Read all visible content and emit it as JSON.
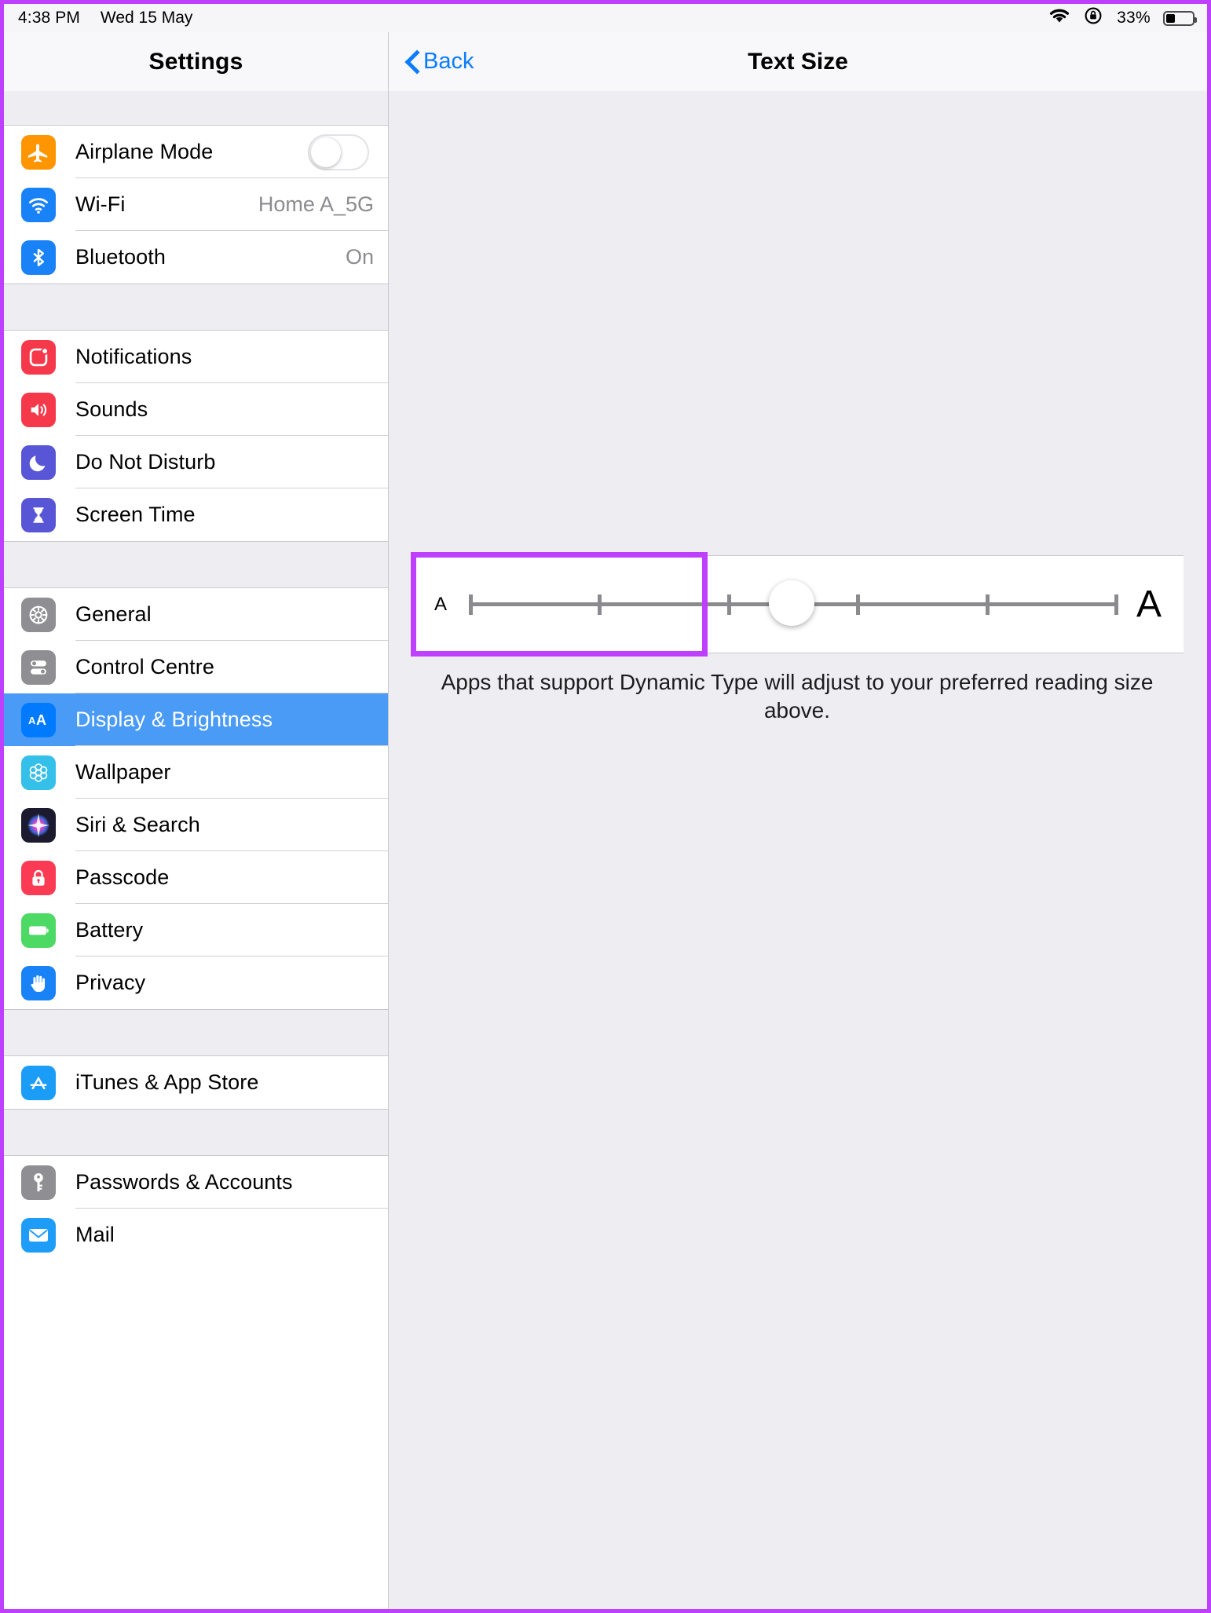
{
  "statusbar": {
    "time": "4:38 PM",
    "date": "Wed 15 May",
    "wifi_icon": "wifi-icon",
    "rotation_lock_icon": "rotation-lock-icon",
    "battery_percent": "33%",
    "battery_level": 33
  },
  "sidebar": {
    "title": "Settings",
    "groups": [
      {
        "items": [
          {
            "label": "Airplane Mode",
            "icon": "airplane-icon",
            "icon_class": "ic-airplane",
            "glyph": "✈",
            "control": "toggle",
            "toggle_on": false
          },
          {
            "label": "Wi-Fi",
            "icon": "wifi-icon",
            "icon_class": "ic-wifi",
            "glyph": "◴",
            "value": "Home A_5G"
          },
          {
            "label": "Bluetooth",
            "icon": "bluetooth-icon",
            "icon_class": "ic-bluetooth",
            "glyph": "ᛦ",
            "value": "On"
          }
        ]
      },
      {
        "items": [
          {
            "label": "Notifications",
            "icon": "notifications-icon",
            "icon_class": "ic-notifications",
            "glyph": "▢"
          },
          {
            "label": "Sounds",
            "icon": "sounds-icon",
            "icon_class": "ic-sounds",
            "glyph": "◂"
          },
          {
            "label": "Do Not Disturb",
            "icon": "moon-icon",
            "icon_class": "ic-dnd",
            "glyph": "☾"
          },
          {
            "label": "Screen Time",
            "icon": "hourglass-icon",
            "icon_class": "ic-screentime",
            "glyph": "⧖"
          }
        ]
      },
      {
        "items": [
          {
            "label": "General",
            "icon": "gear-icon",
            "icon_class": "ic-general",
            "glyph": "⚙"
          },
          {
            "label": "Control Centre",
            "icon": "sliders-icon",
            "icon_class": "ic-control",
            "glyph": "☲"
          },
          {
            "label": "Display & Brightness",
            "icon": "text-size-icon",
            "icon_class": "ic-display",
            "glyph": "AA",
            "selected": true
          },
          {
            "label": "Wallpaper",
            "icon": "flower-icon",
            "icon_class": "ic-wallpaper",
            "glyph": "✿"
          },
          {
            "label": "Siri & Search",
            "icon": "siri-icon",
            "icon_class": "ic-siri",
            "glyph": "✸"
          },
          {
            "label": "Passcode",
            "icon": "lock-icon",
            "icon_class": "ic-passcode",
            "glyph": "ὑ2"
          },
          {
            "label": "Battery",
            "icon": "battery-icon",
            "icon_class": "ic-battery",
            "glyph": "▭"
          },
          {
            "label": "Privacy",
            "icon": "hand-icon",
            "icon_class": "ic-privacy",
            "glyph": "✋"
          }
        ]
      },
      {
        "items": [
          {
            "label": "iTunes & App Store",
            "icon": "app-store-icon",
            "icon_class": "ic-itunes",
            "glyph": "A"
          }
        ]
      },
      {
        "items": [
          {
            "label": "Passwords & Accounts",
            "icon": "key-icon",
            "icon_class": "ic-passwords",
            "glyph": "⚿"
          },
          {
            "label": "Mail",
            "icon": "envelope-icon",
            "icon_class": "ic-mail",
            "glyph": "✉"
          }
        ]
      }
    ]
  },
  "detail": {
    "back_label": "Back",
    "title": "Text Size",
    "slider": {
      "small_letter": "A",
      "large_letter": "A",
      "tick_count": 6,
      "value_index": 3,
      "value_percent": 50
    },
    "caption": "Apps that support Dynamic Type will adjust to your preferred reading size above."
  }
}
